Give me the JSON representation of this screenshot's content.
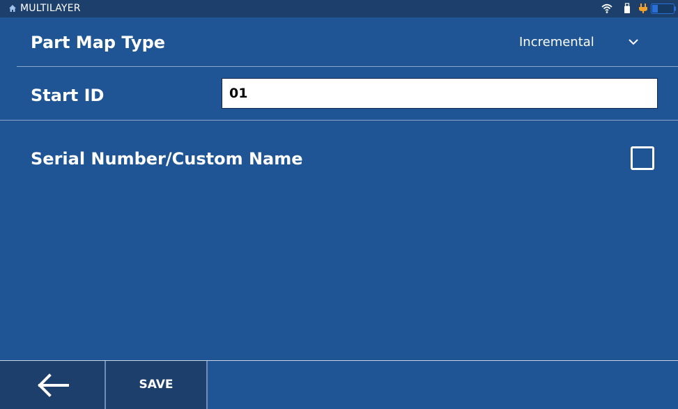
{
  "status_bar": {
    "title": "MULTILAYER",
    "icons": [
      "home-icon",
      "wifi-icon",
      "usb-icon",
      "power-plug-icon",
      "battery-icon"
    ]
  },
  "part_map_type": {
    "label": "Part Map Type",
    "selected_value": "Incremental"
  },
  "start_id": {
    "label": "Start ID",
    "value": "01"
  },
  "serial_number": {
    "label": "Serial Number/Custom Name",
    "checked": false
  },
  "toolbar": {
    "back_icon": "back-arrow-icon",
    "save_label": "SAVE"
  },
  "colors": {
    "background": "#1f5595",
    "status_bar": "#1c3f6b",
    "toolbar_button": "#1c3f6b",
    "power_indicator": "#f2a22c",
    "battery_fill": "#2a6fd6"
  }
}
